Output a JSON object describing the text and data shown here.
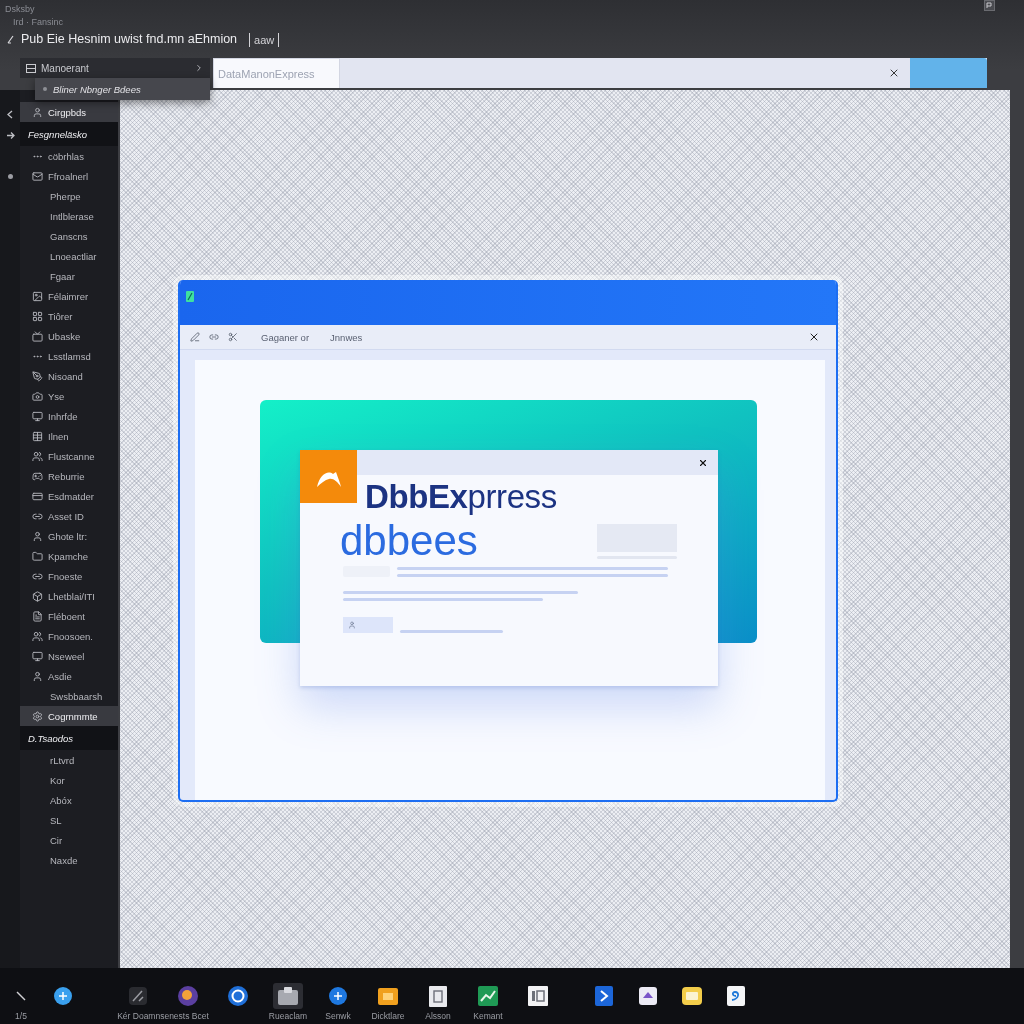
{
  "header": {
    "breadcrumb": "Dsksby",
    "path": "Ird · Fansinc",
    "title": "Pub Eie Hesnim uwist fnd.mn aEhmion",
    "badge": "aaw"
  },
  "menu": {
    "label": "Manoerant",
    "expanded": true,
    "submenu": [
      {
        "label": "Bliner Nbnger Bdees",
        "selected": true
      }
    ]
  },
  "tab_bar": {
    "tabs": [
      {
        "label": "DataManonExpress",
        "selected": true
      }
    ]
  },
  "sidebar": {
    "items": [
      {
        "label": "Cirgpbds",
        "kind": "icon",
        "selected": true
      },
      {
        "label": "Fesgnneläsko",
        "kind": "section",
        "selected": false
      },
      {
        "label": "cöbrhlas",
        "kind": "icon",
        "selected": false
      },
      {
        "label": "Ffroalnerl",
        "kind": "icon",
        "selected": false
      },
      {
        "label": "Pherpe",
        "kind": "text",
        "selected": false
      },
      {
        "label": "Intlblerase",
        "kind": "text",
        "selected": false
      },
      {
        "label": "Ganscns",
        "kind": "text",
        "selected": false
      },
      {
        "label": "Lnoeactliar",
        "kind": "text",
        "selected": false
      },
      {
        "label": "Fgaar",
        "kind": "text",
        "selected": false
      },
      {
        "label": "Félaimrer",
        "kind": "icon",
        "selected": false
      },
      {
        "label": "Tiôrer",
        "kind": "icon",
        "selected": false
      },
      {
        "label": "Ubaske",
        "kind": "icon",
        "selected": false
      },
      {
        "label": "Lsstlamsd",
        "kind": "icon",
        "selected": false
      },
      {
        "label": "Nisoand",
        "kind": "icon",
        "selected": false
      },
      {
        "label": "Yse",
        "kind": "icon",
        "selected": false
      },
      {
        "label": "Inhrfde",
        "kind": "icon",
        "selected": false
      },
      {
        "label": "Ilnen",
        "kind": "icon",
        "selected": false
      },
      {
        "label": "Flustcanne",
        "kind": "icon",
        "selected": false
      },
      {
        "label": "Reburrie",
        "kind": "icon",
        "selected": false
      },
      {
        "label": "Esdmatder",
        "kind": "icon",
        "selected": false
      },
      {
        "label": "Asset ID",
        "kind": "icon",
        "selected": false
      },
      {
        "label": "Ghote ltr:",
        "kind": "icon",
        "selected": false
      },
      {
        "label": "Kpamche",
        "kind": "icon",
        "selected": false
      },
      {
        "label": "Fnoeste",
        "kind": "icon",
        "selected": false
      },
      {
        "label": "Lhetblai/ITI",
        "kind": "icon",
        "selected": false
      },
      {
        "label": "Fléboent",
        "kind": "icon",
        "selected": false
      },
      {
        "label": "Fnoosoen.",
        "kind": "icon",
        "selected": false
      },
      {
        "label": "Nseweel",
        "kind": "icon",
        "selected": false
      },
      {
        "label": "Asdie",
        "kind": "icon",
        "selected": false
      },
      {
        "label": "Swsbbaarsh",
        "kind": "text",
        "selected": false
      },
      {
        "label": "Cogrnmmte",
        "kind": "icon",
        "selected": true
      },
      {
        "label": "D.Tsaodos",
        "kind": "section",
        "selected": false
      },
      {
        "label": "rLtvrd",
        "kind": "text",
        "selected": false
      },
      {
        "label": "Kor",
        "kind": "text",
        "selected": false
      },
      {
        "label": "Abóx",
        "kind": "text",
        "selected": false
      },
      {
        "label": "SL",
        "kind": "text",
        "selected": false
      },
      {
        "label": "Cir",
        "kind": "text",
        "selected": false
      },
      {
        "label": "Naxde",
        "kind": "text",
        "selected": false
      }
    ]
  },
  "window": {
    "menu_items": [
      "Gaganer or",
      "Jnnwes"
    ],
    "dialog": {
      "title": "**DbbEx**prress",
      "subtitle": "dbbees"
    }
  },
  "taskbar": {
    "left": [
      {
        "label": "1/5",
        "active": false
      },
      {
        "active": false
      }
    ],
    "apps": [
      {
        "label": "Kér Doamnsenests Bcet",
        "active": false
      },
      {
        "active": false
      },
      {
        "active": false
      },
      {
        "label": "Rueaclam",
        "active": true
      },
      {
        "label": "Senwk",
        "active": false
      },
      {
        "label": "Dicktlare",
        "active": false
      },
      {
        "label": "Alsson",
        "active": false
      },
      {
        "label": "Kemant",
        "active": false
      },
      {
        "active": false
      }
    ],
    "pinned": [
      {
        "active": false
      },
      {
        "active": false
      },
      {
        "active": false
      },
      {
        "active": false
      }
    ]
  }
}
